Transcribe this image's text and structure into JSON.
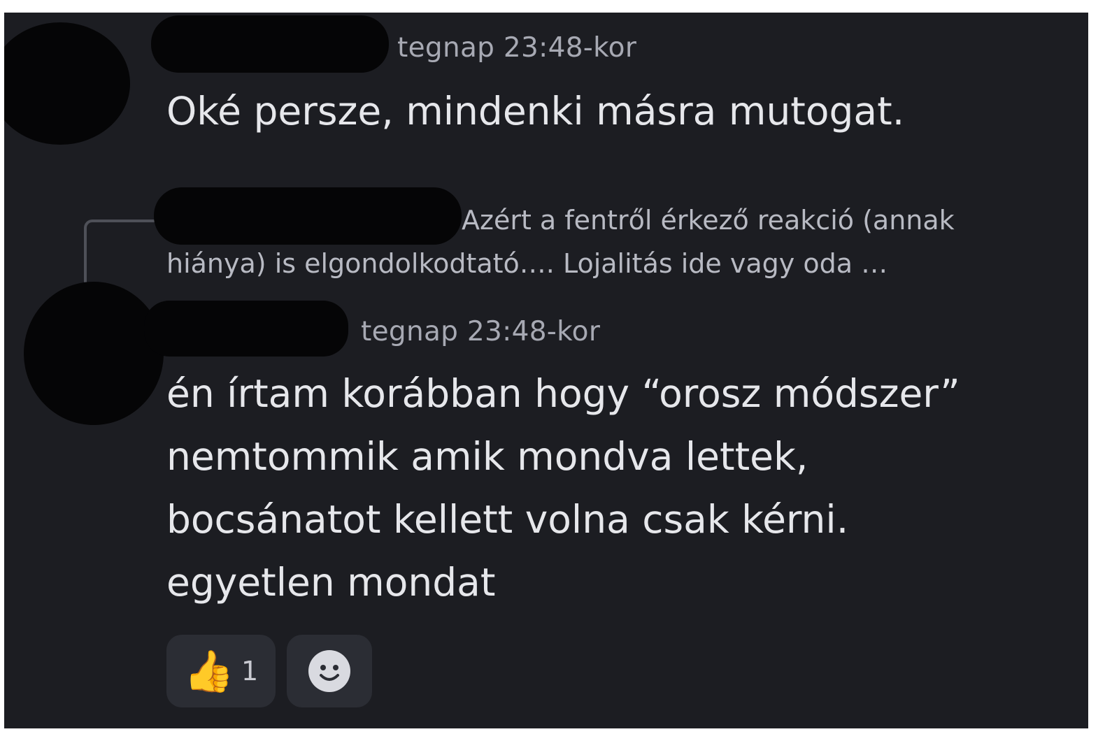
{
  "messages": [
    {
      "timestamp": "tegnap 23:48-kor",
      "text_lines": [
        "Oké persze, mindenki másra mutogat."
      ]
    },
    {
      "reply_preview_lines": [
        "Azért a fentről érkező reakció (annak",
        "hiánya) is elgondolkodtató…. Lojalitás ide vagy oda …"
      ],
      "timestamp": "tegnap 23:48-kor",
      "text_lines": [
        "én írtam korábban hogy “orosz módszer”",
        "nemtommik amik mondva lettek,",
        "bocsánatot kellett volna csak kérni.",
        "egyetlen mondat"
      ],
      "reactions": [
        {
          "emoji": "👍",
          "icon": "thumbs-up-emoji",
          "count": "1"
        },
        {
          "icon": "add-reaction-smiley-icon"
        }
      ]
    }
  ],
  "colors": {
    "chat_background": "#1c1d22",
    "message_text": "#e6e7eb",
    "timestamp_text": "#a7a9b3",
    "reaction_pill": "#2b2d34"
  }
}
